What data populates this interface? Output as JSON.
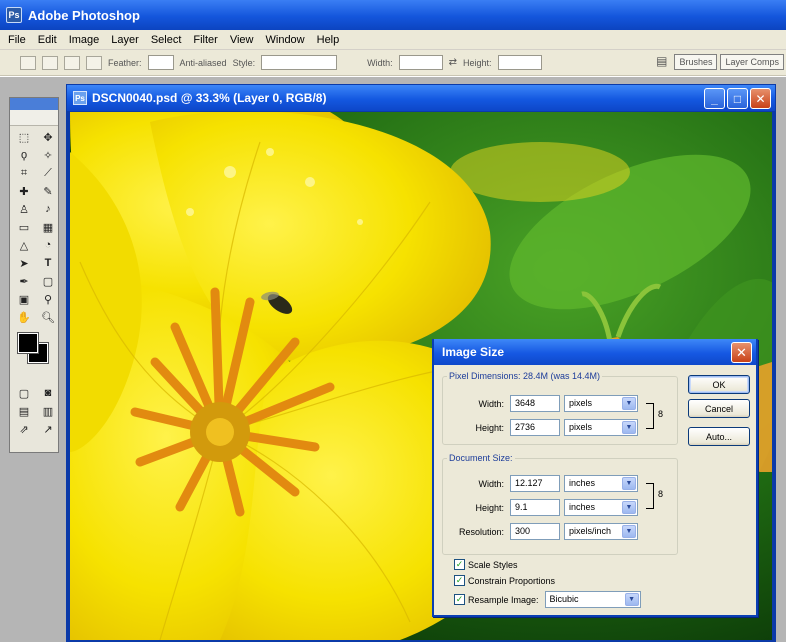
{
  "app": {
    "title": "Adobe Photoshop",
    "icon": "photoshop-app-icon"
  },
  "menu": [
    "File",
    "Edit",
    "Image",
    "Layer",
    "Select",
    "Filter",
    "View",
    "Window",
    "Help"
  ],
  "options_bar": {
    "feather_label": "Feather:",
    "antialias_label": "Anti-aliased",
    "style_label": "Style:",
    "width_label": "Width:",
    "height_label": "Height:",
    "palette_tabs": [
      "Brushes",
      "Layer Comps"
    ]
  },
  "document": {
    "title": "DSCN0040.psd @ 33.3% (Layer 0, RGB/8)",
    "buttons": {
      "minimize": "_",
      "maximize": "□",
      "close": "✕"
    }
  },
  "tools": [
    "marquee",
    "move",
    "lasso",
    "magic-wand",
    "crop",
    "slice",
    "healing",
    "brush",
    "stamp",
    "history-brush",
    "eraser",
    "gradient",
    "blur",
    "dodge",
    "path-select",
    "type",
    "pen",
    "shape",
    "notes",
    "eyedropper",
    "hand",
    "zoom"
  ],
  "colors": {
    "foreground": "#000000",
    "background": "#000000",
    "accent": "#1458e0"
  },
  "dialog": {
    "title": "Image Size",
    "pixel_dimensions": {
      "label": "Pixel Dimensions:  28.4M (was 14.4M)",
      "width": {
        "label": "Width:",
        "value": "3648",
        "unit": "pixels"
      },
      "height": {
        "label": "Height:",
        "value": "2736",
        "unit": "pixels"
      }
    },
    "document_size": {
      "label": "Document Size:",
      "width": {
        "label": "Width:",
        "value": "12.127",
        "unit": "inches"
      },
      "height": {
        "label": "Height:",
        "value": "9.1",
        "unit": "inches"
      },
      "resolution": {
        "label": "Resolution:",
        "value": "300",
        "unit": "pixels/inch"
      }
    },
    "buttons": {
      "ok": "OK",
      "cancel": "Cancel",
      "auto": "Auto..."
    },
    "checkboxes": [
      {
        "label": "Scale Styles",
        "checked": true
      },
      {
        "label": "Constrain Proportions",
        "checked": true
      },
      {
        "label": "Resample Image:",
        "checked": true
      }
    ],
    "resample_method": "Bicubic"
  }
}
